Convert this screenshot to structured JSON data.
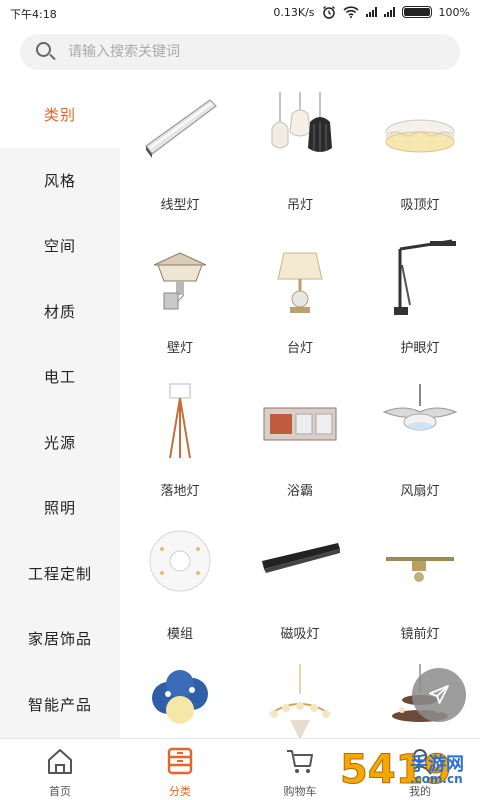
{
  "status_bar": {
    "time": "下午4:18",
    "speed": "0.13K/s",
    "battery": "100%",
    "battery_level": 1.0
  },
  "search": {
    "placeholder": "请输入搜索关键词",
    "icon": "search-icon"
  },
  "sidebar": {
    "items": [
      {
        "label": "类别",
        "active": true
      },
      {
        "label": "风格",
        "active": false
      },
      {
        "label": "空间",
        "active": false
      },
      {
        "label": "材质",
        "active": false
      },
      {
        "label": "电工",
        "active": false
      },
      {
        "label": "光源",
        "active": false
      },
      {
        "label": "照明",
        "active": false
      },
      {
        "label": "工程定制",
        "active": false
      },
      {
        "label": "家居饰品",
        "active": false
      },
      {
        "label": "智能产品",
        "active": false
      }
    ]
  },
  "products": [
    {
      "label": "线型灯",
      "icon": "linear-light-icon"
    },
    {
      "label": "吊灯",
      "icon": "pendant-light-icon"
    },
    {
      "label": "吸顶灯",
      "icon": "ceiling-light-icon"
    },
    {
      "label": "壁灯",
      "icon": "wall-lamp-icon"
    },
    {
      "label": "台灯",
      "icon": "table-lamp-icon"
    },
    {
      "label": "护眼灯",
      "icon": "desk-eye-lamp-icon"
    },
    {
      "label": "落地灯",
      "icon": "floor-lamp-icon"
    },
    {
      "label": "浴霸",
      "icon": "bath-heater-icon"
    },
    {
      "label": "风扇灯",
      "icon": "fan-light-icon"
    },
    {
      "label": "模组",
      "icon": "led-module-icon"
    },
    {
      "label": "磁吸灯",
      "icon": "magnetic-track-icon"
    },
    {
      "label": "镜前灯",
      "icon": "mirror-light-icon"
    },
    {
      "label": "",
      "icon": "kids-lamp-icon"
    },
    {
      "label": "",
      "icon": "crystal-chandelier-icon"
    },
    {
      "label": "",
      "icon": "tiered-chandelier-icon"
    }
  ],
  "bottom_nav": [
    {
      "label": "首页",
      "icon": "home-icon",
      "active": false
    },
    {
      "label": "分类",
      "icon": "category-icon",
      "active": true
    },
    {
      "label": "购物车",
      "icon": "cart-icon",
      "active": false
    },
    {
      "label": "我的",
      "icon": "profile-icon",
      "active": false
    }
  ],
  "watermark": {
    "number": "5419",
    "site_name": "手游网",
    "site_url": ".com.cn"
  },
  "colors": {
    "accent": "#e4662a",
    "sidebar_bg": "#f5f5f5",
    "search_bg": "#f2f2f2"
  }
}
